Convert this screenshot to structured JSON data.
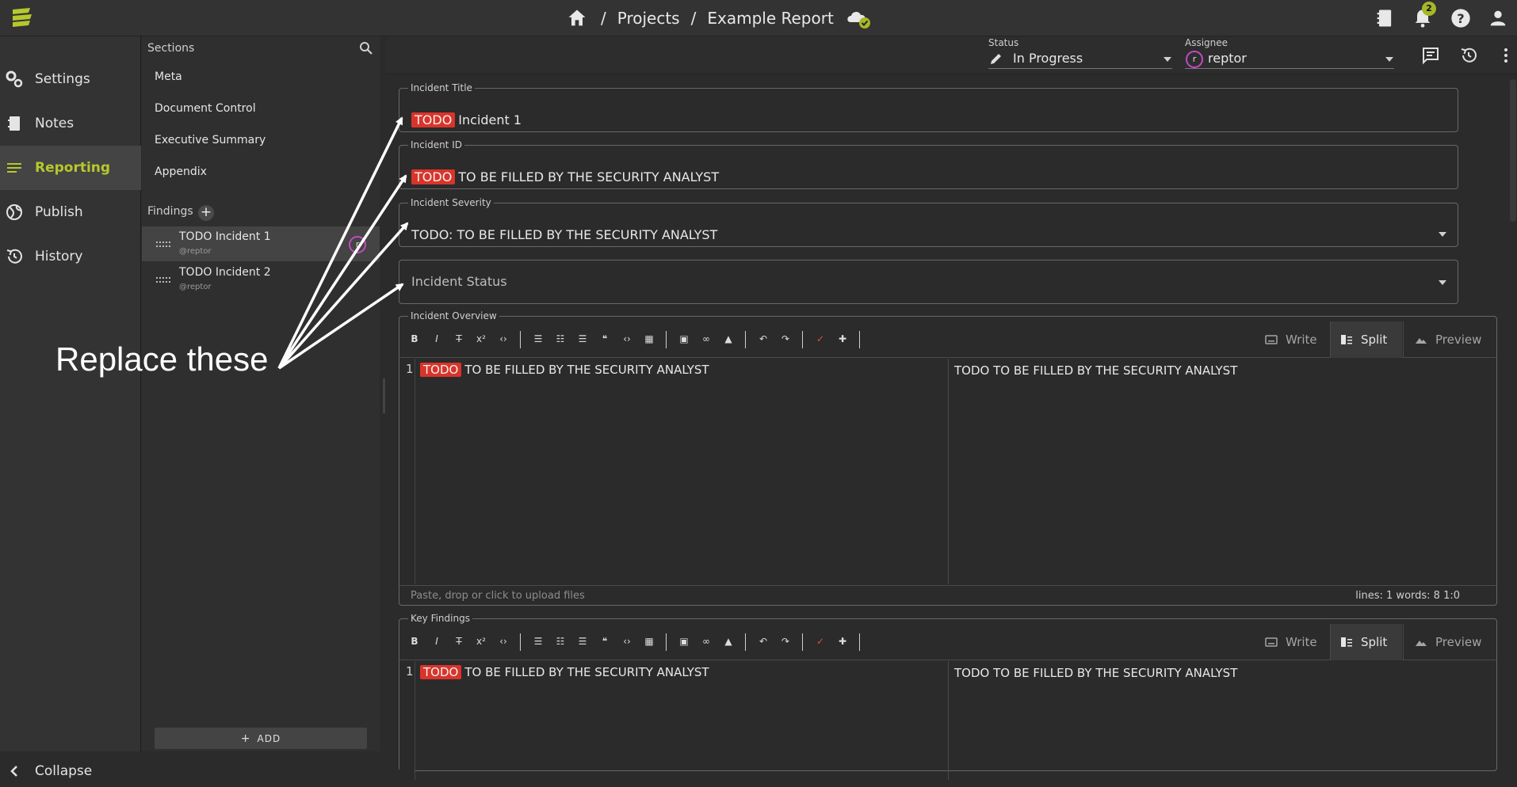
{
  "app": {
    "breadcrumb": [
      "Projects",
      "Example Report"
    ],
    "separator": "/",
    "notification_count": "2"
  },
  "nav": {
    "items": [
      {
        "label": "Settings",
        "icon": "gear-icon"
      },
      {
        "label": "Notes",
        "icon": "notebook-icon"
      },
      {
        "label": "Reporting",
        "icon": "list-icon",
        "active": true
      },
      {
        "label": "Publish",
        "icon": "globe-icon"
      },
      {
        "label": "History",
        "icon": "history-icon"
      }
    ],
    "collapse_label": "Collapse"
  },
  "sections": {
    "header": "Sections",
    "items": [
      "Meta",
      "Document Control",
      "Executive Summary",
      "Appendix"
    ],
    "findings_header": "Findings",
    "findings": [
      {
        "title": "TODO Incident 1",
        "owner": "@reptor",
        "avatar": "r"
      },
      {
        "title": "TODO Incident 2",
        "owner": "@reptor"
      }
    ],
    "add_label": "ADD",
    "add_icon": "+"
  },
  "header": {
    "status_label": "Status",
    "status_value": "In Progress",
    "assignee_label": "Assignee",
    "assignee_value": "reptor",
    "assignee_avatar": "r"
  },
  "fields": {
    "todo_tag": "TODO",
    "incident_title": {
      "label": "Incident Title",
      "value": "Incident 1"
    },
    "incident_id": {
      "label": "Incident ID",
      "value": "TO BE FILLED BY THE SECURITY ANALYST"
    },
    "incident_severity": {
      "label": "Incident Severity",
      "value": "TODO: TO BE FILLED BY THE SECURITY ANALYST"
    },
    "incident_status": {
      "placeholder": "Incident Status"
    }
  },
  "editors": {
    "modes": [
      "Write",
      "Split",
      "Preview"
    ],
    "active_mode": "Split",
    "overview": {
      "label": "Incident Overview",
      "line_number": "1",
      "code": "TO BE FILLED BY THE SECURITY ANALYST",
      "preview": "TODO TO BE FILLED BY THE SECURITY ANALYST",
      "upload_hint": "Paste, drop or click to upload files",
      "stats": "lines: 1     words: 8    1:0"
    },
    "key_findings": {
      "label": "Key Findings",
      "line_number": "1",
      "code": "TO BE FILLED BY THE SECURITY ANALYST",
      "preview": "TODO TO BE FILLED BY THE SECURITY ANALYST"
    }
  },
  "annotation": {
    "text": "Replace these"
  },
  "colors": {
    "accent": "#b6c82c",
    "todo": "#d9342b",
    "avatar_ring": "#c24ac3"
  }
}
